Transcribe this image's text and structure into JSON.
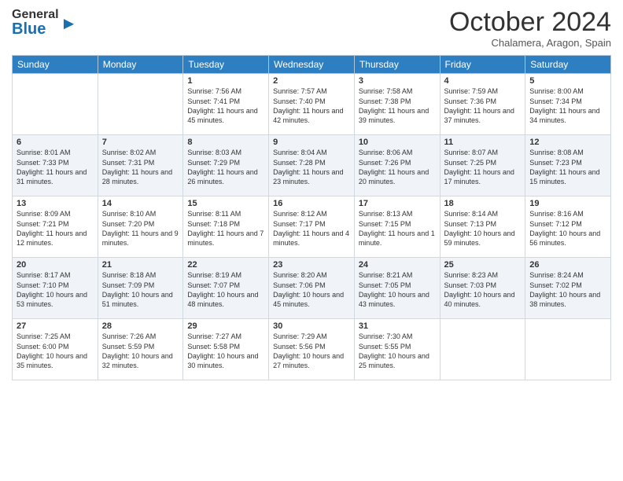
{
  "header": {
    "logo_general": "General",
    "logo_blue": "Blue",
    "month_title": "October 2024",
    "location": "Chalamera, Aragon, Spain"
  },
  "weekdays": [
    "Sunday",
    "Monday",
    "Tuesday",
    "Wednesday",
    "Thursday",
    "Friday",
    "Saturday"
  ],
  "rows": [
    [
      {
        "day": "",
        "sunrise": "",
        "sunset": "",
        "daylight": "",
        "empty": true
      },
      {
        "day": "",
        "sunrise": "",
        "sunset": "",
        "daylight": "",
        "empty": true
      },
      {
        "day": "1",
        "sunrise": "Sunrise: 7:56 AM",
        "sunset": "Sunset: 7:41 PM",
        "daylight": "Daylight: 11 hours and 45 minutes."
      },
      {
        "day": "2",
        "sunrise": "Sunrise: 7:57 AM",
        "sunset": "Sunset: 7:40 PM",
        "daylight": "Daylight: 11 hours and 42 minutes."
      },
      {
        "day": "3",
        "sunrise": "Sunrise: 7:58 AM",
        "sunset": "Sunset: 7:38 PM",
        "daylight": "Daylight: 11 hours and 39 minutes."
      },
      {
        "day": "4",
        "sunrise": "Sunrise: 7:59 AM",
        "sunset": "Sunset: 7:36 PM",
        "daylight": "Daylight: 11 hours and 37 minutes."
      },
      {
        "day": "5",
        "sunrise": "Sunrise: 8:00 AM",
        "sunset": "Sunset: 7:34 PM",
        "daylight": "Daylight: 11 hours and 34 minutes."
      }
    ],
    [
      {
        "day": "6",
        "sunrise": "Sunrise: 8:01 AM",
        "sunset": "Sunset: 7:33 PM",
        "daylight": "Daylight: 11 hours and 31 minutes."
      },
      {
        "day": "7",
        "sunrise": "Sunrise: 8:02 AM",
        "sunset": "Sunset: 7:31 PM",
        "daylight": "Daylight: 11 hours and 28 minutes."
      },
      {
        "day": "8",
        "sunrise": "Sunrise: 8:03 AM",
        "sunset": "Sunset: 7:29 PM",
        "daylight": "Daylight: 11 hours and 26 minutes."
      },
      {
        "day": "9",
        "sunrise": "Sunrise: 8:04 AM",
        "sunset": "Sunset: 7:28 PM",
        "daylight": "Daylight: 11 hours and 23 minutes."
      },
      {
        "day": "10",
        "sunrise": "Sunrise: 8:06 AM",
        "sunset": "Sunset: 7:26 PM",
        "daylight": "Daylight: 11 hours and 20 minutes."
      },
      {
        "day": "11",
        "sunrise": "Sunrise: 8:07 AM",
        "sunset": "Sunset: 7:25 PM",
        "daylight": "Daylight: 11 hours and 17 minutes."
      },
      {
        "day": "12",
        "sunrise": "Sunrise: 8:08 AM",
        "sunset": "Sunset: 7:23 PM",
        "daylight": "Daylight: 11 hours and 15 minutes."
      }
    ],
    [
      {
        "day": "13",
        "sunrise": "Sunrise: 8:09 AM",
        "sunset": "Sunset: 7:21 PM",
        "daylight": "Daylight: 11 hours and 12 minutes."
      },
      {
        "day": "14",
        "sunrise": "Sunrise: 8:10 AM",
        "sunset": "Sunset: 7:20 PM",
        "daylight": "Daylight: 11 hours and 9 minutes."
      },
      {
        "day": "15",
        "sunrise": "Sunrise: 8:11 AM",
        "sunset": "Sunset: 7:18 PM",
        "daylight": "Daylight: 11 hours and 7 minutes."
      },
      {
        "day": "16",
        "sunrise": "Sunrise: 8:12 AM",
        "sunset": "Sunset: 7:17 PM",
        "daylight": "Daylight: 11 hours and 4 minutes."
      },
      {
        "day": "17",
        "sunrise": "Sunrise: 8:13 AM",
        "sunset": "Sunset: 7:15 PM",
        "daylight": "Daylight: 11 hours and 1 minute."
      },
      {
        "day": "18",
        "sunrise": "Sunrise: 8:14 AM",
        "sunset": "Sunset: 7:13 PM",
        "daylight": "Daylight: 10 hours and 59 minutes."
      },
      {
        "day": "19",
        "sunrise": "Sunrise: 8:16 AM",
        "sunset": "Sunset: 7:12 PM",
        "daylight": "Daylight: 10 hours and 56 minutes."
      }
    ],
    [
      {
        "day": "20",
        "sunrise": "Sunrise: 8:17 AM",
        "sunset": "Sunset: 7:10 PM",
        "daylight": "Daylight: 10 hours and 53 minutes."
      },
      {
        "day": "21",
        "sunrise": "Sunrise: 8:18 AM",
        "sunset": "Sunset: 7:09 PM",
        "daylight": "Daylight: 10 hours and 51 minutes."
      },
      {
        "day": "22",
        "sunrise": "Sunrise: 8:19 AM",
        "sunset": "Sunset: 7:07 PM",
        "daylight": "Daylight: 10 hours and 48 minutes."
      },
      {
        "day": "23",
        "sunrise": "Sunrise: 8:20 AM",
        "sunset": "Sunset: 7:06 PM",
        "daylight": "Daylight: 10 hours and 45 minutes."
      },
      {
        "day": "24",
        "sunrise": "Sunrise: 8:21 AM",
        "sunset": "Sunset: 7:05 PM",
        "daylight": "Daylight: 10 hours and 43 minutes."
      },
      {
        "day": "25",
        "sunrise": "Sunrise: 8:23 AM",
        "sunset": "Sunset: 7:03 PM",
        "daylight": "Daylight: 10 hours and 40 minutes."
      },
      {
        "day": "26",
        "sunrise": "Sunrise: 8:24 AM",
        "sunset": "Sunset: 7:02 PM",
        "daylight": "Daylight: 10 hours and 38 minutes."
      }
    ],
    [
      {
        "day": "27",
        "sunrise": "Sunrise: 7:25 AM",
        "sunset": "Sunset: 6:00 PM",
        "daylight": "Daylight: 10 hours and 35 minutes."
      },
      {
        "day": "28",
        "sunrise": "Sunrise: 7:26 AM",
        "sunset": "Sunset: 5:59 PM",
        "daylight": "Daylight: 10 hours and 32 minutes."
      },
      {
        "day": "29",
        "sunrise": "Sunrise: 7:27 AM",
        "sunset": "Sunset: 5:58 PM",
        "daylight": "Daylight: 10 hours and 30 minutes."
      },
      {
        "day": "30",
        "sunrise": "Sunrise: 7:29 AM",
        "sunset": "Sunset: 5:56 PM",
        "daylight": "Daylight: 10 hours and 27 minutes."
      },
      {
        "day": "31",
        "sunrise": "Sunrise: 7:30 AM",
        "sunset": "Sunset: 5:55 PM",
        "daylight": "Daylight: 10 hours and 25 minutes."
      },
      {
        "day": "",
        "sunrise": "",
        "sunset": "",
        "daylight": "",
        "empty": true
      },
      {
        "day": "",
        "sunrise": "",
        "sunset": "",
        "daylight": "",
        "empty": true
      }
    ]
  ],
  "shaded_rows": [
    1,
    3
  ]
}
